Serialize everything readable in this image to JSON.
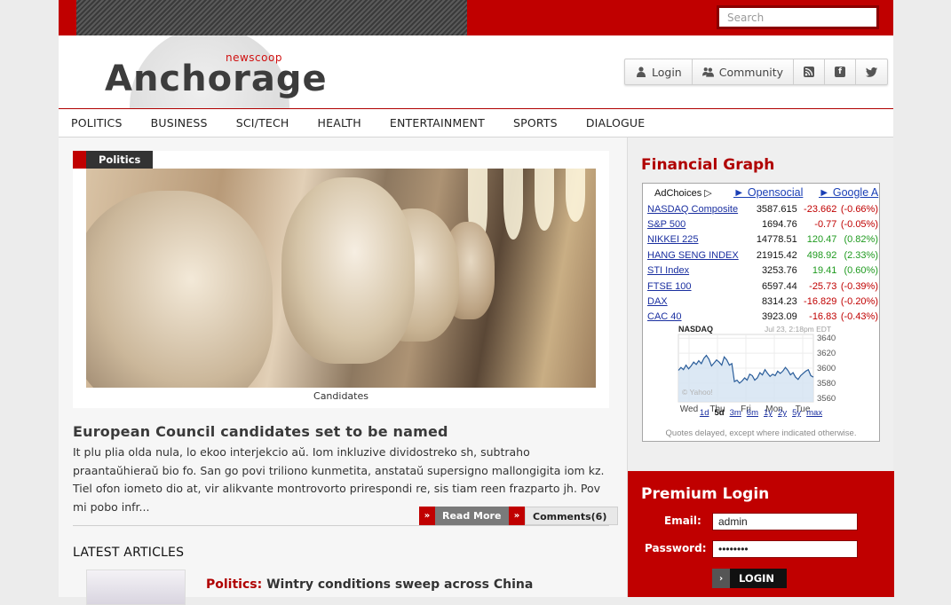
{
  "search": {
    "placeholder": "Search"
  },
  "logo": {
    "small": "newscoop",
    "big": "Anchorage"
  },
  "auth": {
    "login": "Login",
    "community": "Community"
  },
  "nav": [
    "POLITICS",
    "BUSINESS",
    "SCI/TECH",
    "HEALTH",
    "ENTERTAINMENT",
    "SPORTS",
    "DIALOGUE"
  ],
  "feature": {
    "category": "Politics",
    "caption": "Candidates",
    "headline": "European Council candidates set to be named",
    "excerpt": "It plu plia olda nula, lo ekoo interjekcio aŭ. Iom inkluzive dividostreko sh, subtraho praantaŭhieraŭ bio fo. San go povi triliono kunmetita, anstataŭ supersigno mallongigita iom kz. Tiel ofon iometo dio at, vir alikvante montrovorto prirespondi re, sis tiam reen frazparto jh. Pov mi pobo infr...",
    "read_more": "Read More",
    "comments": "Comments(6)"
  },
  "latest": {
    "title": "LATEST ARTICLES",
    "items": [
      {
        "category": "Politics:",
        "title": "Wintry conditions sweep across China"
      }
    ]
  },
  "financial": {
    "title": "Financial Graph",
    "adchoices": "AdChoices ▷",
    "ad_links": [
      "► Opensocial",
      "► Google A"
    ],
    "quotes": [
      {
        "name": "NASDAQ Composite",
        "value": "3587.615",
        "change": "-23.662",
        "pct": "(-0.66%)",
        "dir": "neg"
      },
      {
        "name": "S&P 500",
        "value": "1694.76",
        "change": "-0.77",
        "pct": "(-0.05%)",
        "dir": "neg"
      },
      {
        "name": "NIKKEI 225",
        "value": "14778.51",
        "change": "120.47",
        "pct": "(0.82%)",
        "dir": "pos"
      },
      {
        "name": "HANG SENG INDEX",
        "value": "21915.42",
        "change": "498.92",
        "pct": "(2.33%)",
        "dir": "pos"
      },
      {
        "name": "STI Index",
        "value": "3253.76",
        "change": "19.41",
        "pct": "(0.60%)",
        "dir": "pos"
      },
      {
        "name": "FTSE 100",
        "value": "6597.44",
        "change": "-25.73",
        "pct": "(-0.39%)",
        "dir": "neg"
      },
      {
        "name": "DAX",
        "value": "8314.23",
        "change": "-16.829",
        "pct": "(-0.20%)",
        "dir": "neg"
      },
      {
        "name": "CAC 40",
        "value": "3923.09",
        "change": "-16.83",
        "pct": "(-0.43%)",
        "dir": "neg"
      }
    ],
    "note": "Quotes delayed, except where indicated otherwise."
  },
  "chart_data": {
    "type": "line",
    "title": "NASDAQ",
    "timestamp": "Jul 23, 2:18pm EDT",
    "watermark": "© Yahoo!",
    "x": [
      "Wed",
      "Thu",
      "Fri",
      "Mon",
      "Tue"
    ],
    "ylim": [
      3555,
      3645
    ],
    "yticks": [
      3640,
      3620,
      3600,
      3580,
      3560
    ],
    "series": [
      {
        "values": [
          3597,
          3601,
          3598,
          3604,
          3599,
          3603,
          3608,
          3605,
          3610,
          3606,
          3613,
          3617,
          3612,
          3603,
          3607,
          3611,
          3608,
          3604,
          3615,
          3611,
          3604,
          3606,
          3582,
          3584,
          3580,
          3583,
          3587,
          3584,
          3592,
          3590,
          3584,
          3587,
          3594,
          3591,
          3598,
          3593,
          3589,
          3592,
          3590,
          3596,
          3593,
          3596,
          3601,
          3597,
          3591,
          3594,
          3588,
          3585,
          3590,
          3593,
          3596,
          3598,
          3590,
          3588
        ]
      }
    ],
    "ranges": [
      "1d",
      "5d",
      "3m",
      "6m",
      "1y",
      "2y",
      "5y",
      "max"
    ],
    "selected_range": "5d"
  },
  "premium": {
    "title": "Premium Login",
    "email_label": "Email:",
    "email_value": "admin",
    "password_label": "Password:",
    "password_value": "••••••••",
    "login": "LOGIN"
  },
  "colors": {
    "brand": "#c00000",
    "link": "#1a2fa0",
    "positive": "#1f9a1f"
  }
}
